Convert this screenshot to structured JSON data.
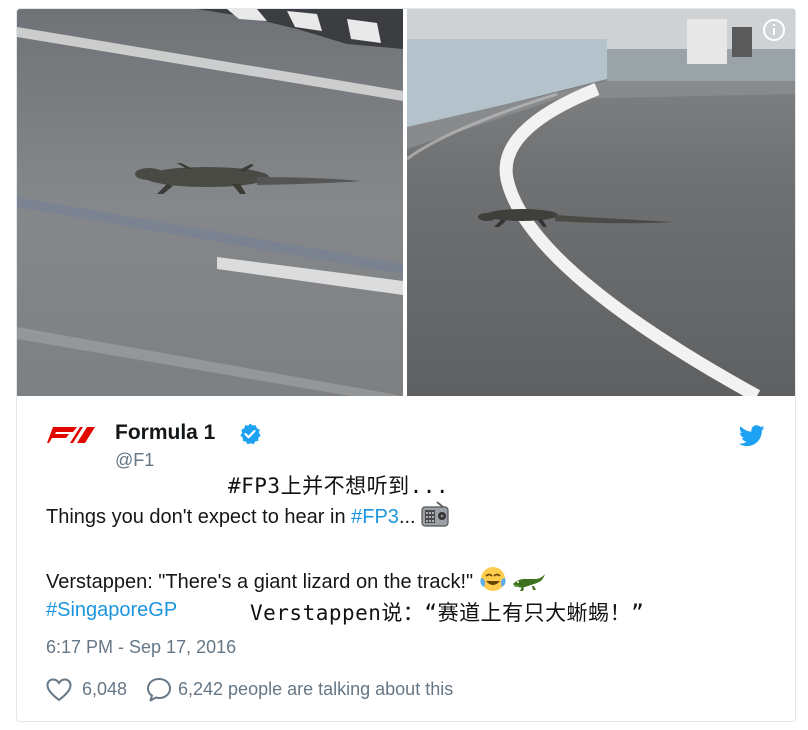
{
  "media": {
    "left_photo": "lizard on track (left photo)",
    "right_photo": "lizard crossing track line (right photo)",
    "info_icon": "info-icon"
  },
  "account": {
    "display_name": "Formula 1",
    "handle": "@F1",
    "logo": "f1-logo",
    "verified_icon": "verified-icon",
    "platform_icon": "twitter-bird-icon"
  },
  "annotations": {
    "top": "#FP3上并不想听到...",
    "bottom": "Verstappen说：“赛道上有只大蜥蜴！”"
  },
  "tweet": {
    "line1_text": "Things you don't expect to hear in ",
    "line1_hashtag": "#FP3",
    "line1_suffix": "... ",
    "line1_emoji": "radio-emoji",
    "line2_text": "Verstappen: \"There's a giant lizard on the track!\" ",
    "line2_emojis": [
      "tears-of-joy-emoji",
      "crocodile-emoji"
    ],
    "line3_hashtag": "#SingaporeGP"
  },
  "timestamp": "6:17 PM - Sep 17, 2016",
  "engagement": {
    "likes": "6,048",
    "talking": "6,242 people are talking about this"
  },
  "colors": {
    "link": "#1b95e0",
    "muted": "#657786",
    "text": "#14171a",
    "f1_red": "#e10600",
    "verified_blue": "#1da1f2"
  }
}
